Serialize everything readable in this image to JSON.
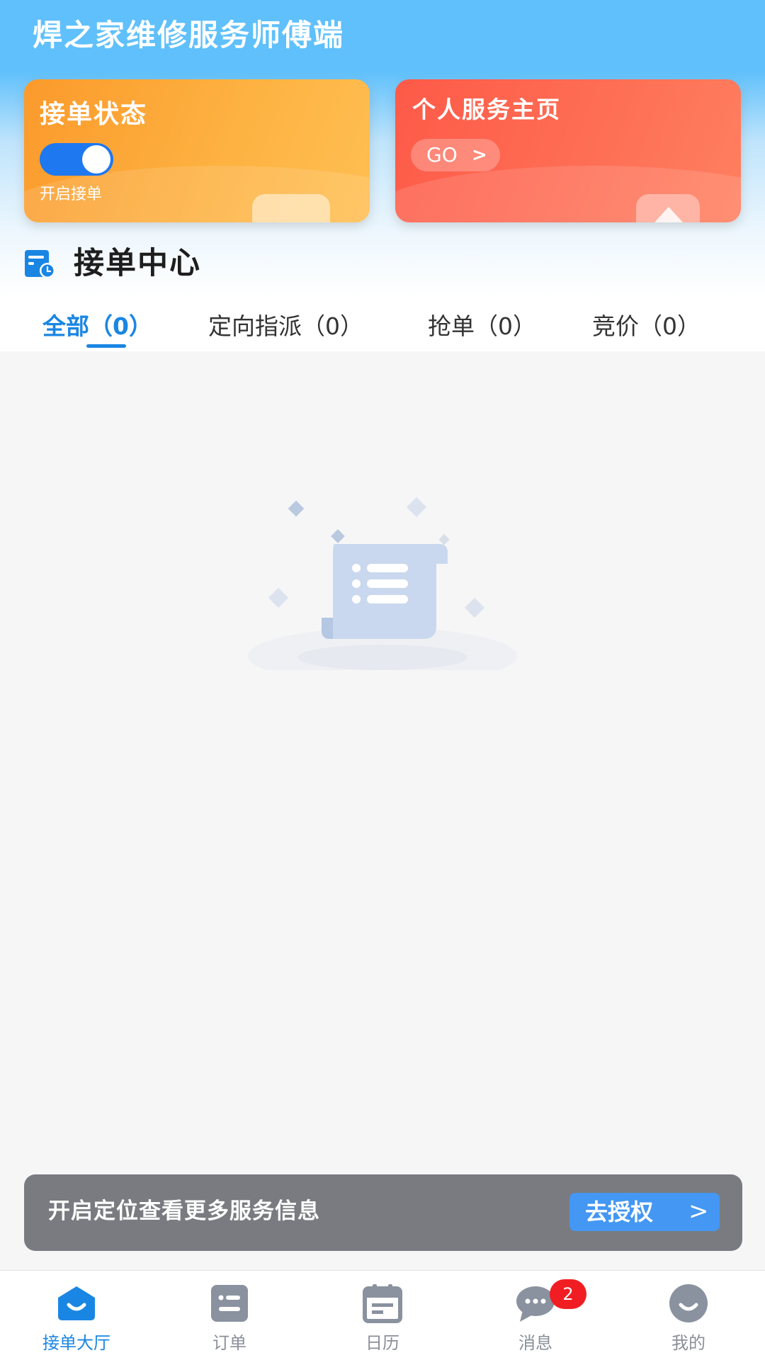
{
  "app": {
    "title": "焊之家维修服务师傅端"
  },
  "cards": {
    "status": {
      "title": "接单状态",
      "toggle_label": "开启接单",
      "toggle_on": true
    },
    "home": {
      "title": "个人服务主页",
      "go_label": "GO",
      "go_chevron": ">"
    }
  },
  "section": {
    "title": "接单中心",
    "icon": "order-clock-icon"
  },
  "tabs": [
    {
      "label": "全部（0）",
      "active": true
    },
    {
      "label": "定向指派（0）",
      "active": false
    },
    {
      "label": "抢单（0）",
      "active": false
    },
    {
      "label": "竞价（0）",
      "active": false
    }
  ],
  "empty_state": {
    "icon": "empty-scroll-icon"
  },
  "location_bar": {
    "text": "开启定位查看更多服务信息",
    "button_label": "去授权",
    "button_chevron": ">"
  },
  "bottom_nav": [
    {
      "label": "接单大厅",
      "icon": "hall-icon",
      "active": true
    },
    {
      "label": "订单",
      "icon": "order-list-icon",
      "active": false
    },
    {
      "label": "日历",
      "icon": "calendar-icon",
      "active": false
    },
    {
      "label": "消息",
      "icon": "message-icon",
      "active": false,
      "badge": "2"
    },
    {
      "label": "我的",
      "icon": "profile-icon",
      "active": false
    }
  ],
  "colors": {
    "accent": "#1a86e3",
    "header": "#5fc0fb",
    "status_card": "#fdb140",
    "home_card": "#fe6e55",
    "badge": "#f01e23"
  }
}
